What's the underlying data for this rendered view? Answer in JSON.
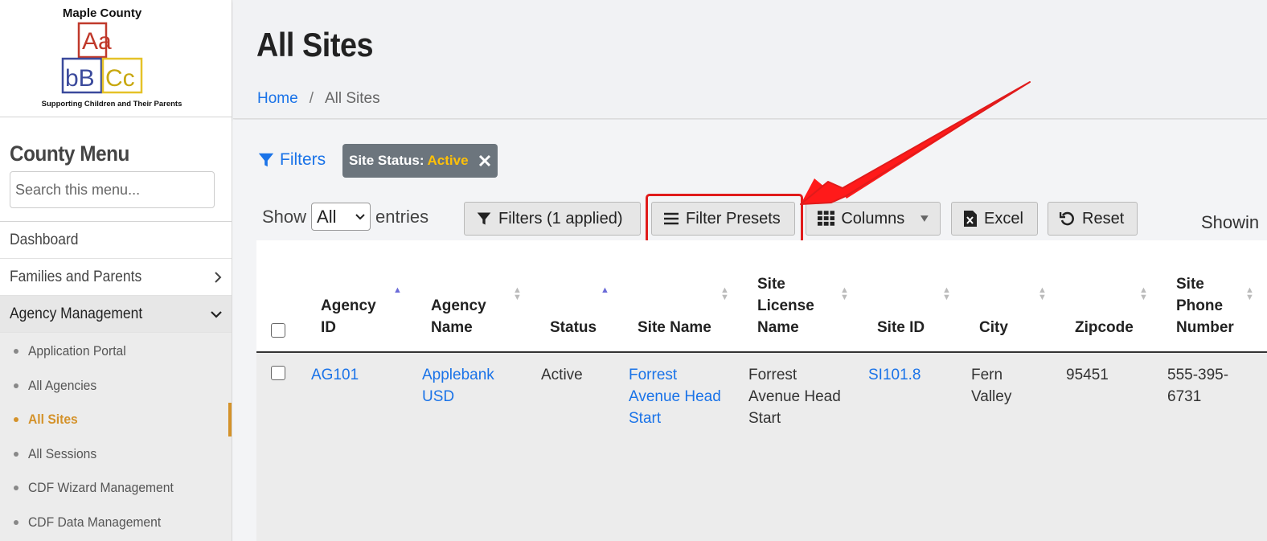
{
  "logo": {
    "title": "Maple County",
    "tagline": "Supporting Children and Their Parents",
    "blocks": [
      "Aa",
      "bB",
      "Cc"
    ],
    "colors": {
      "red": "#c0392b",
      "blue": "#3b4a9c",
      "yellow": "#e5c228"
    }
  },
  "sidebar": {
    "menu_title": "County Menu",
    "search_placeholder": "Search this menu...",
    "items": [
      {
        "label": "Dashboard"
      },
      {
        "label": "Families and Parents",
        "icon": "chevron-right-icon"
      },
      {
        "label": "Agency Management",
        "icon": "chevron-down-icon"
      }
    ],
    "sub_items": [
      {
        "label": "Application Portal"
      },
      {
        "label": "All Agencies"
      },
      {
        "label": "All Sites",
        "active": true
      },
      {
        "label": "All Sessions"
      },
      {
        "label": "CDF Wizard Management"
      },
      {
        "label": "CDF Data Management"
      }
    ],
    "active_color": "#d4922a"
  },
  "header": {
    "title": "All Sites",
    "breadcrumb": {
      "home": "Home",
      "sep": "/",
      "current": "All Sites"
    }
  },
  "toolbar": {
    "filters_link": "Filters",
    "chip": {
      "label": "Site Status:",
      "value": "Active"
    },
    "show_label": "Show",
    "entries_label": "entries",
    "length_value": "All",
    "filters_applied": "Filters (1 applied)",
    "filter_presets": "Filter Presets",
    "columns": "Columns",
    "excel": "Excel",
    "reset": "Reset",
    "showing": "Showin"
  },
  "table": {
    "headers": {
      "agency_id": [
        "Agency",
        "ID"
      ],
      "agency_name": [
        "Agency",
        "Name"
      ],
      "status": [
        "Status"
      ],
      "site_name": [
        "Site Name"
      ],
      "site_license_name": [
        "Site",
        "License",
        "Name"
      ],
      "site_id": [
        "Site ID"
      ],
      "city": [
        "City"
      ],
      "zipcode": [
        "Zipcode"
      ],
      "site_phone": [
        "Site",
        "Phone",
        "Number"
      ]
    },
    "rows": [
      {
        "agency_id": "AG101",
        "agency_name": [
          "Applebank",
          "USD"
        ],
        "status": "Active",
        "site_name": [
          "Forrest",
          "Avenue Head",
          "Start"
        ],
        "site_license_name": [
          "Forrest",
          "Avenue Head",
          "Start"
        ],
        "site_id": "SI101.8",
        "city": [
          "Fern",
          "Valley"
        ],
        "zipcode": "95451",
        "site_phone": [
          "555-395-",
          "6731"
        ]
      }
    ]
  },
  "accent": {
    "link": "#1a73e8",
    "annotation": "#e01b1b",
    "chip_value": "#ffc107"
  }
}
